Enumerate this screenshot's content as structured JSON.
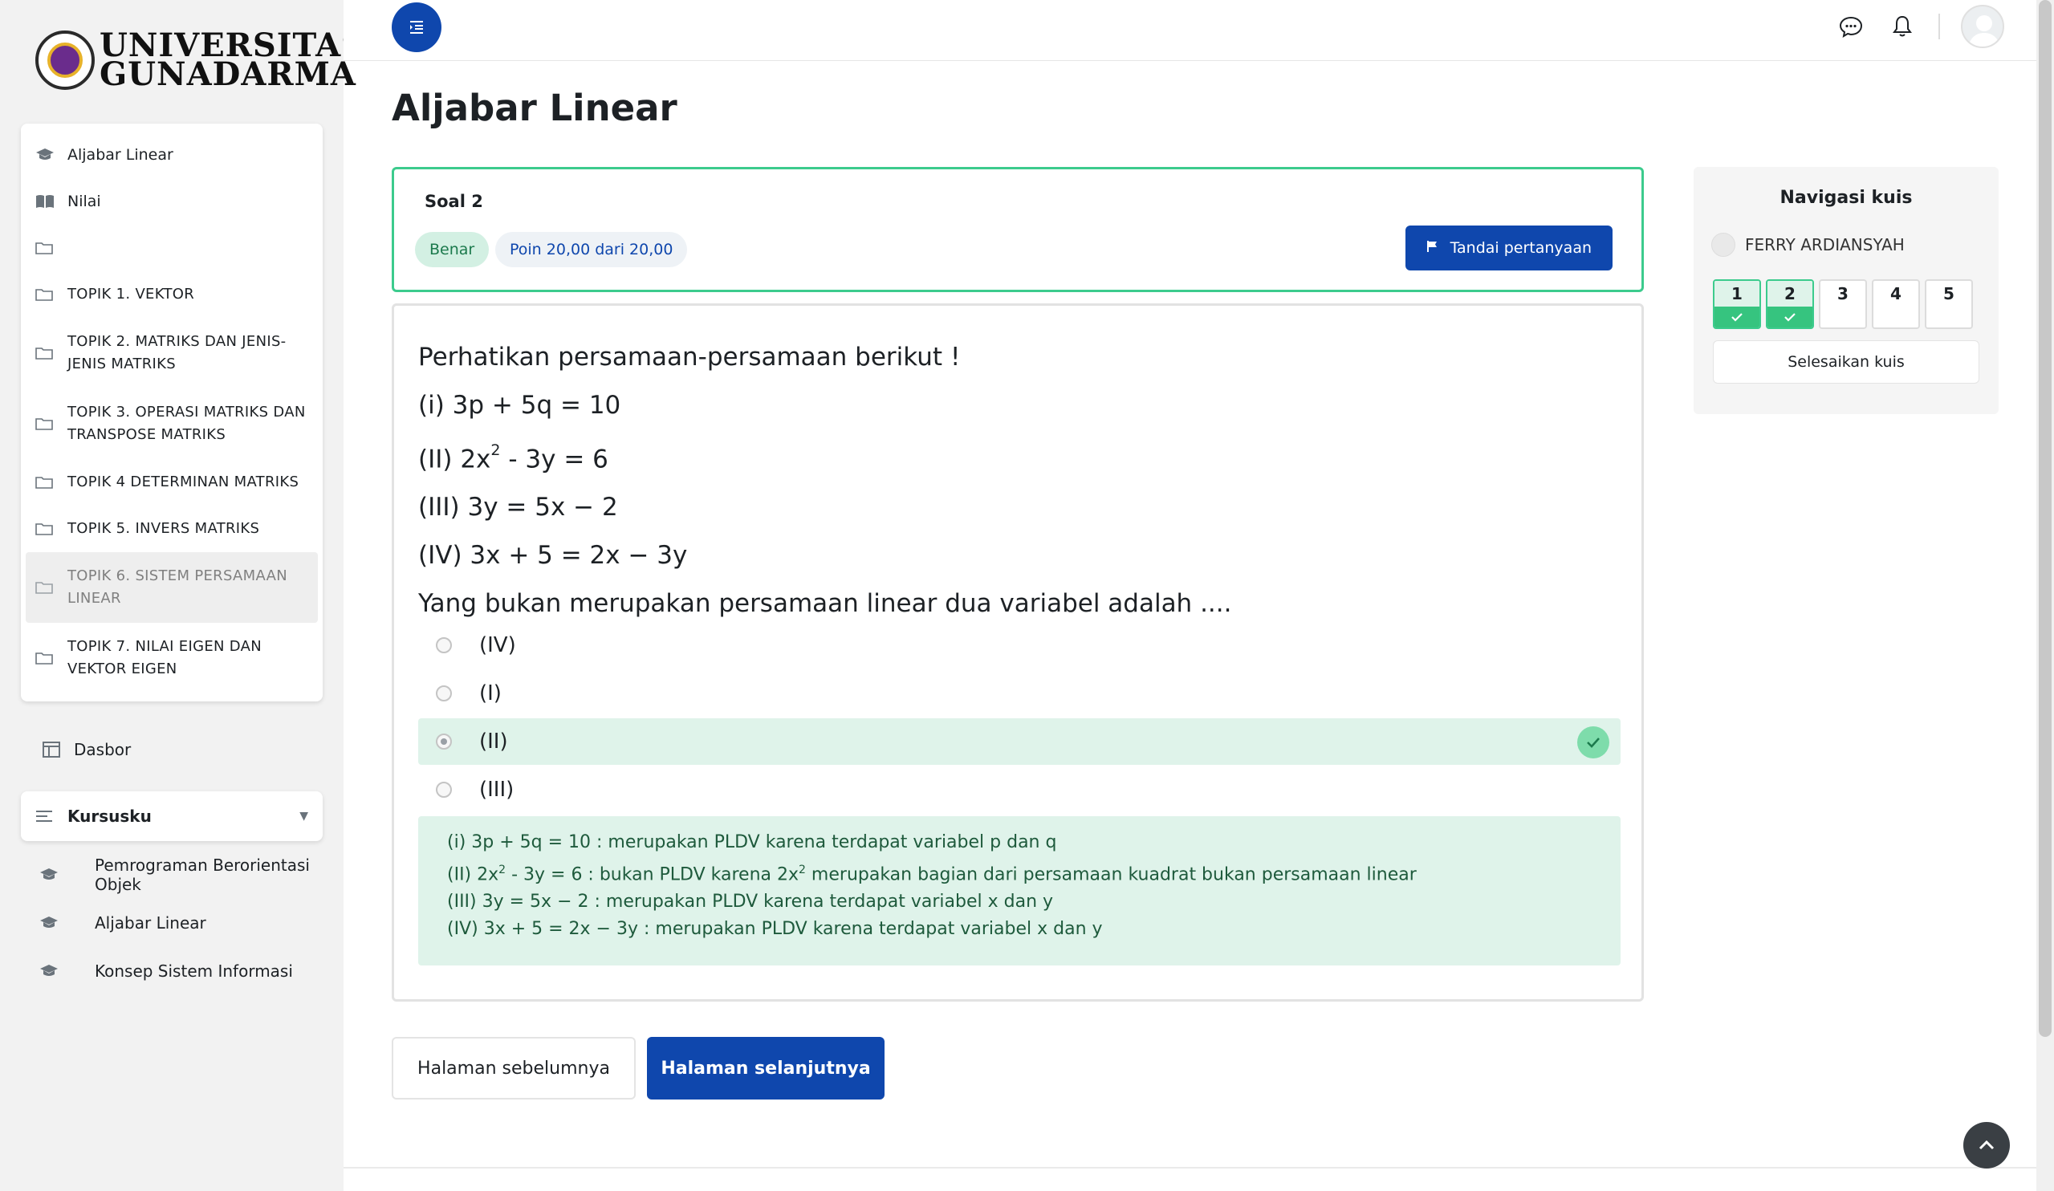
{
  "brand": {
    "line1": "UNIVERSITAS",
    "line2": "GUNADARMA"
  },
  "sidebar": {
    "items": [
      {
        "label": "Aljabar Linear",
        "icon": "graduation-cap-icon"
      },
      {
        "label": "Nilai",
        "icon": "book-open-icon"
      },
      {
        "label": "",
        "icon": "folder-icon"
      },
      {
        "label": "TOPIK 1. VEKTOR",
        "icon": "folder-icon"
      },
      {
        "label": "TOPIK 2. MATRIKS DAN JENIS-JENIS MATRIKS",
        "icon": "folder-icon"
      },
      {
        "label": "TOPIK 3. OPERASI MATRIKS DAN TRANSPOSE MATRIKS",
        "icon": "folder-icon"
      },
      {
        "label": "TOPIK 4 DETERMINAN MATRIKS",
        "icon": "folder-icon"
      },
      {
        "label": "TOPIK 5. INVERS MATRIKS",
        "icon": "folder-icon"
      },
      {
        "label": "TOPIK 6. SISTEM PERSAMAAN LINEAR",
        "icon": "folder-icon",
        "active": true
      },
      {
        "label": "TOPIK 7. NILAI EIGEN DAN VEKTOR EIGEN",
        "icon": "folder-icon"
      }
    ],
    "dasbor": "Dasbor",
    "kursusku": "Kursusku",
    "courses": [
      "Pemrograman Berorientasi Objek",
      "Aljabar Linear",
      "Konsep Sistem Informasi"
    ]
  },
  "page": {
    "title": "Aljabar Linear"
  },
  "question": {
    "number_label": "Soal 2",
    "status": "Benar",
    "points": "Poin 20,00 dari 20,00",
    "flag_label": "Tandai pertanyaan",
    "lines": {
      "intro": "Perhatikan persamaan-persamaan berikut !",
      "eq1": "(i) 3p + 5q = 10",
      "eq2_pre": "(II) 2x",
      "eq2_sup": "2",
      "eq2_post": " - 3y = 6",
      "eq3": "(III) 3y = 5x − 2",
      "eq4": "(IV) 3x + 5 = 2x − 3y",
      "prompt": "Yang bukan merupakan persamaan linear dua variabel adalah ...."
    },
    "options": [
      {
        "label": "(IV)"
      },
      {
        "label": "(I)"
      },
      {
        "label": "(II)",
        "selected": true,
        "correct": true
      },
      {
        "label": "(III)"
      }
    ],
    "feedback": {
      "l1": "(i) 3p + 5q = 10 : merupakan PLDV karena terdapat variabel p dan q",
      "l2_a": "(II) 2x",
      "l2_sup1": "2",
      "l2_b": " - 3y = 6 : bukan PLDV karena 2x",
      "l2_sup2": "2",
      "l2_c": " merupakan bagian dari persamaan kuadrat bukan persamaan linear",
      "l3": "(III) 3y = 5x − 2 : merupakan PLDV karena terdapat variabel x dan y",
      "l4": "(IV) 3x + 5 = 2x − 3y : merupakan PLDV karena terdapat variabel x dan y"
    }
  },
  "paging": {
    "prev": "Halaman sebelumnya",
    "next": "Halaman selanjutnya"
  },
  "quiz_nav": {
    "title": "Navigasi kuis",
    "user": "FERRY ARDIANSYAH",
    "buttons": [
      {
        "num": "1",
        "answered": true
      },
      {
        "num": "2",
        "answered": true
      },
      {
        "num": "3",
        "answered": false
      },
      {
        "num": "4",
        "answered": false
      },
      {
        "num": "5",
        "answered": false
      }
    ],
    "finish": "Selesaikan kuis"
  },
  "colors": {
    "primary": "#0f47ad",
    "success": "#3ccb8d",
    "success_bg": "#dff3ea"
  }
}
